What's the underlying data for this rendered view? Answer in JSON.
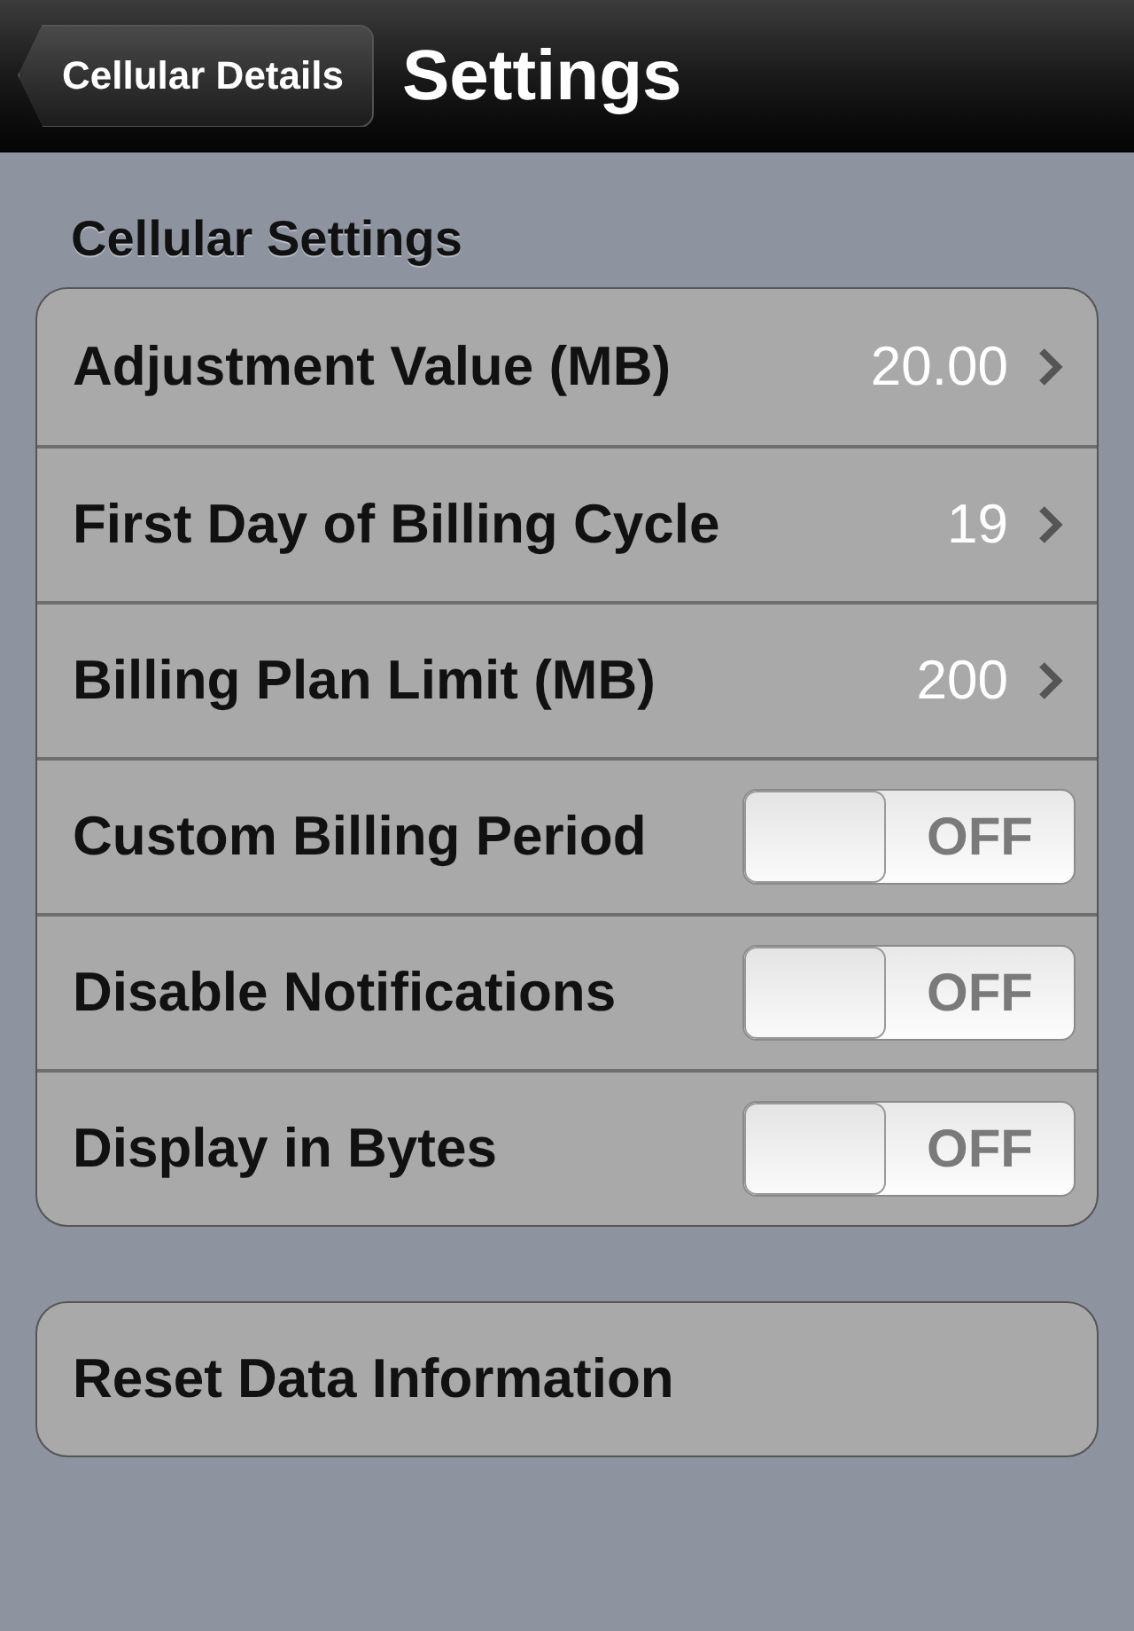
{
  "nav_bar": {
    "back_button": "Cellular Details",
    "title": "Settings"
  },
  "section": {
    "header": "Cellular Settings",
    "rows": [
      {
        "kind": "value",
        "label": "Adjustment Value (MB)",
        "value": "20.00"
      },
      {
        "kind": "value",
        "label": "First Day of Billing Cycle",
        "value": "19"
      },
      {
        "kind": "value",
        "label": "Billing Plan Limit (MB)",
        "value": "200"
      },
      {
        "kind": "switch",
        "label": "Custom Billing Period",
        "switch_text": "OFF",
        "on": false
      },
      {
        "kind": "switch",
        "label": "Disable Notifications",
        "switch_text": "OFF",
        "on": false
      },
      {
        "kind": "switch",
        "label": "Display in Bytes",
        "switch_text": "OFF",
        "on": false
      }
    ]
  },
  "action": {
    "label": "Reset Data Information"
  }
}
